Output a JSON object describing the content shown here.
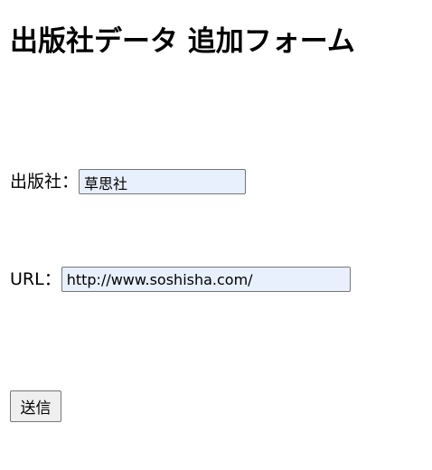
{
  "page": {
    "title": "出版社データ 追加フォーム"
  },
  "form": {
    "publisher": {
      "label": "出版社：",
      "value": "草思社"
    },
    "url": {
      "label": "URL：",
      "value": "http://www.soshisha.com/"
    },
    "submit_label": "送信"
  },
  "colors": {
    "input_autofill_background": "#e8f0fe",
    "button_background": "#efefef",
    "border": "#767676"
  }
}
